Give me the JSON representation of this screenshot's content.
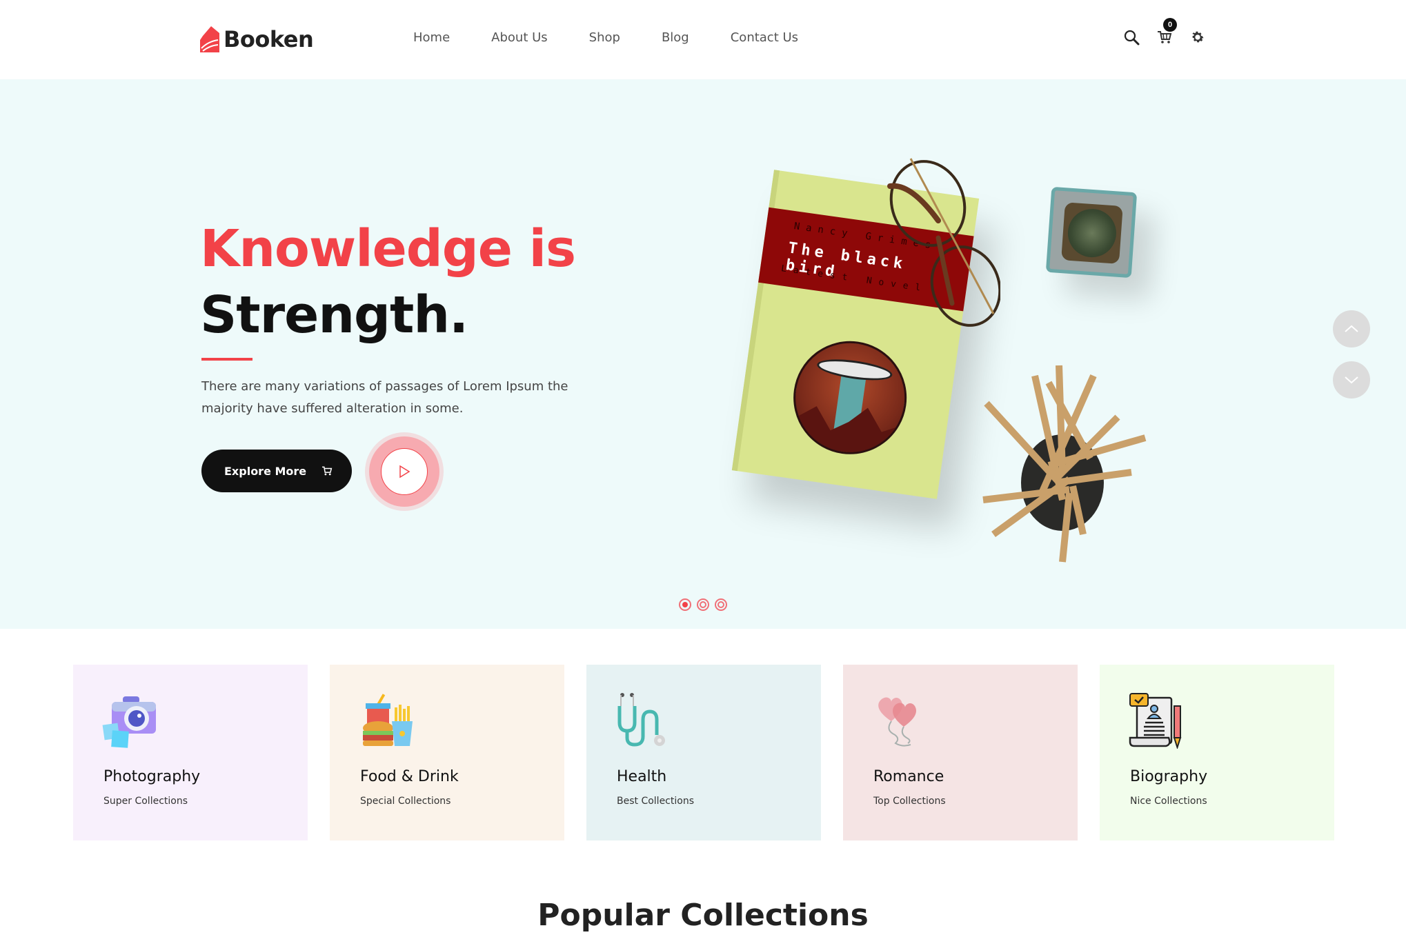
{
  "brand": {
    "name": "Booken",
    "accent": "#f24248"
  },
  "nav": {
    "items": [
      {
        "label": "Home"
      },
      {
        "label": "About Us"
      },
      {
        "label": "Shop"
      },
      {
        "label": "Blog"
      },
      {
        "label": "Contact Us"
      }
    ]
  },
  "header_icons": {
    "search": "search-icon",
    "cart": "cart-icon",
    "cart_count": "0",
    "settings": "gear-icon"
  },
  "hero": {
    "title_line1": "Knowledge is",
    "title_line2": "Strength.",
    "description": "There are many variations of passages of Lorem Ipsum the majority have suffered alteration in some.",
    "cta_label": "Explore More",
    "book": {
      "author": "Nancy Grimes",
      "title": "The black bird",
      "subtitle": "Latest Novel"
    },
    "slides": {
      "count": 3,
      "active": 1
    }
  },
  "categories": [
    {
      "title": "Photography",
      "subtitle": "Super Collections",
      "icon": "camera-icon",
      "bg": "#f8f0fc"
    },
    {
      "title": "Food & Drink",
      "subtitle": "Special Collections",
      "icon": "fast-food-icon",
      "bg": "#fbf3ea"
    },
    {
      "title": "Health",
      "subtitle": "Best Collections",
      "icon": "stethoscope-icon",
      "bg": "#e6f2f3"
    },
    {
      "title": "Romance",
      "subtitle": "Top Collections",
      "icon": "heart-balloons-icon",
      "bg": "#f5e4e4"
    },
    {
      "title": "Biography",
      "subtitle": "Nice Collections",
      "icon": "biography-document-icon",
      "bg": "#f2fdec"
    }
  ],
  "popular": {
    "title": "Popular Collections"
  }
}
